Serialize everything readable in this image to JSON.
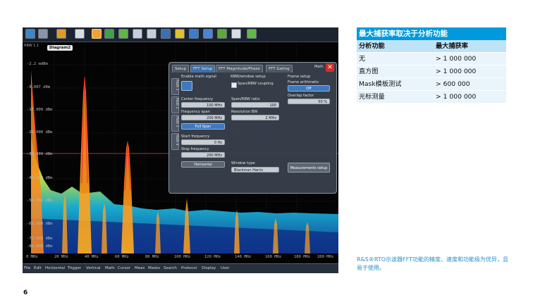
{
  "scope": {
    "diagram_label": "Diagram2",
    "corner_text": "RBW 1.1",
    "toolbar_icons": [
      "undo-icon",
      "redo-icon",
      "autoset-icon",
      "display-icon",
      "touch-icon",
      "run-icon",
      "zoom-icon",
      "cursor-icon",
      "measure-icon",
      "histogram-icon",
      "mask-icon",
      "math-icon",
      "search-icon",
      "protocol-icon",
      "cut-icon",
      "save-icon"
    ],
    "db_labels": [
      "-2.2 mdBm",
      "-9.007 dBm",
      "-17.000 dBm",
      "-26.000 dBm",
      "-36.000 dBm",
      "-45.000 dBm",
      "-54.000 dBm",
      "-63.000 dBm",
      "-72.000 dBm",
      "-81.000 dBm"
    ],
    "freq_labels": [
      "0 MHz",
      "20 MHz",
      "40 MHz",
      "60 MHz",
      "80 MHz",
      "100 MHz",
      "120 MHz",
      "140 MHz",
      "160 MHz",
      "180 MHz",
      "200 MHz"
    ],
    "menu": [
      "File",
      "Edit",
      "Horizontal",
      "Trigger",
      "Vertical",
      "Math",
      "Cursor",
      "Meas",
      "Masks",
      "Search",
      "Protocol",
      "Display",
      "User"
    ],
    "dialog": {
      "title": "Math",
      "tabs": [
        "Setup",
        "FFT Setup",
        "FFT Magnitude/Phase",
        "FFT Gating"
      ],
      "side_tabs": [
        "Math 1",
        "Math 2",
        "Math 3",
        "Math 4"
      ],
      "enable_label": "Enable math signal",
      "center_freq_label": "Center frequency",
      "center_freq_value": "100 MHz",
      "span_label": "Frequency span",
      "span_value": "200 MHz",
      "full_span": "Full Span",
      "start_label": "Start frequency",
      "start_value": "0 Hz",
      "stop_label": "Stop frequency",
      "stop_value": "200 MHz",
      "horizontal_btn": "Horizontal",
      "rbw_header": "RBW/window setup",
      "coupling_label": "Span/RBW coupling",
      "ratio_label": "Span/RBW ratio",
      "ratio_value": "100",
      "rbw_label": "Resolution BW",
      "rbw_value": "2 MHz",
      "window_label": "Window type",
      "window_value": "Blackman Harris",
      "frame_header": "Frame setup",
      "arith_label": "Frame arithmetic",
      "arith_value": "Off",
      "overlap_label": "Overlap factor",
      "overlap_value": "50 %",
      "meas_btn": "Measurements setup"
    }
  },
  "table": {
    "title": "最大捕获率取决于分析功能",
    "headers": [
      "分析功能",
      "最大捕获率"
    ],
    "rows": [
      [
        "无",
        "> 1 000 000"
      ],
      [
        "直方图",
        "> 1 000 000"
      ],
      [
        "Mask模板测试",
        "> 600 000"
      ],
      [
        "光标测量",
        "> 1 000 000"
      ]
    ]
  },
  "caption": "R&S®RTO示波器FFT功能的精度、速度和功能极为优异，且易于使用。",
  "page_number": "6",
  "colors": {
    "accent": "#0099dd",
    "table_header": "#bfe3f6",
    "table_body": "#e9f4fb",
    "caption": "#2a8fc9"
  }
}
